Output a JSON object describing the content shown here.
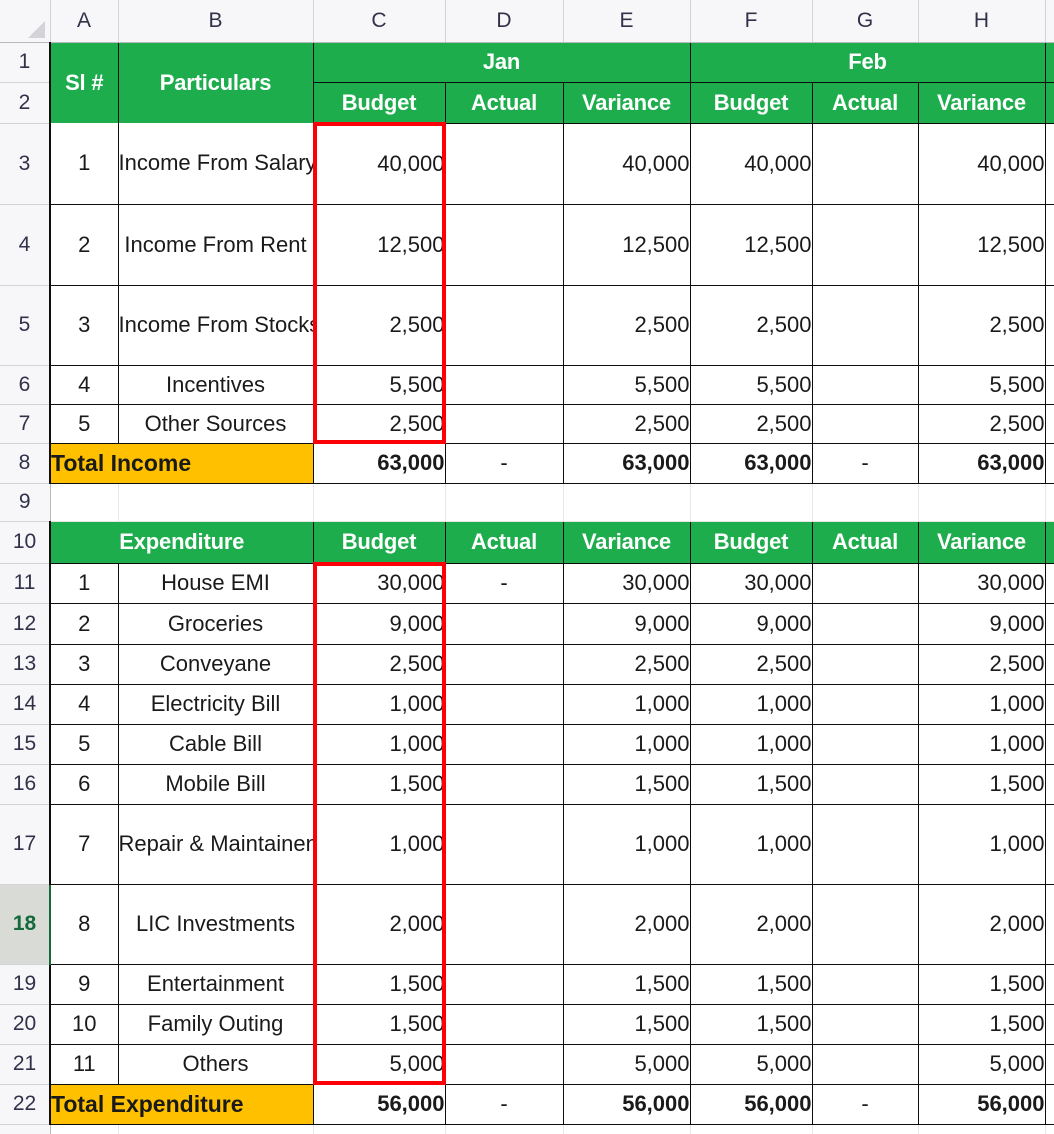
{
  "app": {
    "type": "spreadsheet",
    "accent_green": "#1ead4d",
    "accent_gold": "#ffc000",
    "selection_red": "#fb0007",
    "active_row": "18",
    "active_cell": "A18"
  },
  "column_headers": [
    "A",
    "B",
    "C",
    "D",
    "E",
    "F",
    "G",
    "H"
  ],
  "row_headers": [
    "1",
    "2",
    "3",
    "4",
    "5",
    "6",
    "7",
    "8",
    "9",
    "10",
    "11",
    "12",
    "13",
    "14",
    "15",
    "16",
    "17",
    "18",
    "19",
    "20",
    "21",
    "22"
  ],
  "headers": {
    "sl": "Sl #",
    "particulars": "Particulars",
    "month1": "Jan",
    "month2": "Feb",
    "sub": [
      "Budget",
      "Actual",
      "Variance"
    ],
    "expenditure": "Expenditure"
  },
  "income": {
    "rows": [
      {
        "sl": "1",
        "name": "Income From Salary",
        "jan_budget": "40,000",
        "jan_actual": "",
        "jan_variance": "40,000",
        "feb_budget": "40,000",
        "feb_actual": "",
        "feb_variance": "40,000"
      },
      {
        "sl": "2",
        "name": "Income From Rent",
        "jan_budget": "12,500",
        "jan_actual": "",
        "jan_variance": "12,500",
        "feb_budget": "12,500",
        "feb_actual": "",
        "feb_variance": "12,500"
      },
      {
        "sl": "3",
        "name": "Income From Stocks",
        "jan_budget": "2,500",
        "jan_actual": "",
        "jan_variance": "2,500",
        "feb_budget": "2,500",
        "feb_actual": "",
        "feb_variance": "2,500"
      },
      {
        "sl": "4",
        "name": "Incentives",
        "jan_budget": "5,500",
        "jan_actual": "",
        "jan_variance": "5,500",
        "feb_budget": "5,500",
        "feb_actual": "",
        "feb_variance": "5,500"
      },
      {
        "sl": "5",
        "name": "Other Sources",
        "jan_budget": "2,500",
        "jan_actual": "",
        "jan_variance": "2,500",
        "feb_budget": "2,500",
        "feb_actual": "",
        "feb_variance": "2,500"
      }
    ],
    "total": {
      "label": "Total Income",
      "jan_budget": "63,000",
      "jan_actual": "-",
      "jan_variance": "63,000",
      "feb_budget": "63,000",
      "feb_actual": "-",
      "feb_variance": "63,000"
    }
  },
  "expenditure": {
    "rows": [
      {
        "sl": "1",
        "name": "House EMI",
        "jan_budget": "30,000",
        "jan_actual": "-",
        "jan_variance": "30,000",
        "feb_budget": "30,000",
        "feb_actual": "",
        "feb_variance": "30,000"
      },
      {
        "sl": "2",
        "name": "Groceries",
        "jan_budget": "9,000",
        "jan_actual": "",
        "jan_variance": "9,000",
        "feb_budget": "9,000",
        "feb_actual": "",
        "feb_variance": "9,000"
      },
      {
        "sl": "3",
        "name": "Conveyane",
        "jan_budget": "2,500",
        "jan_actual": "",
        "jan_variance": "2,500",
        "feb_budget": "2,500",
        "feb_actual": "",
        "feb_variance": "2,500"
      },
      {
        "sl": "4",
        "name": "Electricity Bill",
        "jan_budget": "1,000",
        "jan_actual": "",
        "jan_variance": "1,000",
        "feb_budget": "1,000",
        "feb_actual": "",
        "feb_variance": "1,000"
      },
      {
        "sl": "5",
        "name": "Cable Bill",
        "jan_budget": "1,000",
        "jan_actual": "",
        "jan_variance": "1,000",
        "feb_budget": "1,000",
        "feb_actual": "",
        "feb_variance": "1,000"
      },
      {
        "sl": "6",
        "name": "Mobile Bill",
        "jan_budget": "1,500",
        "jan_actual": "",
        "jan_variance": "1,500",
        "feb_budget": "1,500",
        "feb_actual": "",
        "feb_variance": "1,500"
      },
      {
        "sl": "7",
        "name": "Repair & Maintainence",
        "jan_budget": "1,000",
        "jan_actual": "",
        "jan_variance": "1,000",
        "feb_budget": "1,000",
        "feb_actual": "",
        "feb_variance": "1,000"
      },
      {
        "sl": "8",
        "name": "LIC Investments",
        "jan_budget": "2,000",
        "jan_actual": "",
        "jan_variance": "2,000",
        "feb_budget": "2,000",
        "feb_actual": "",
        "feb_variance": "2,000"
      },
      {
        "sl": "9",
        "name": "Entertainment",
        "jan_budget": "1,500",
        "jan_actual": "",
        "jan_variance": "1,500",
        "feb_budget": "1,500",
        "feb_actual": "",
        "feb_variance": "1,500"
      },
      {
        "sl": "10",
        "name": "Family Outing",
        "jan_budget": "1,500",
        "jan_actual": "",
        "jan_variance": "1,500",
        "feb_budget": "1,500",
        "feb_actual": "",
        "feb_variance": "1,500"
      },
      {
        "sl": "11",
        "name": "Others",
        "jan_budget": "5,000",
        "jan_actual": "",
        "jan_variance": "5,000",
        "feb_budget": "5,000",
        "feb_actual": "",
        "feb_variance": "5,000"
      }
    ],
    "total": {
      "label": "Total Expenditure",
      "jan_budget": "56,000",
      "jan_actual": "-",
      "jan_variance": "56,000",
      "feb_budget": "56,000",
      "feb_actual": "-",
      "feb_variance": "56,000"
    }
  }
}
